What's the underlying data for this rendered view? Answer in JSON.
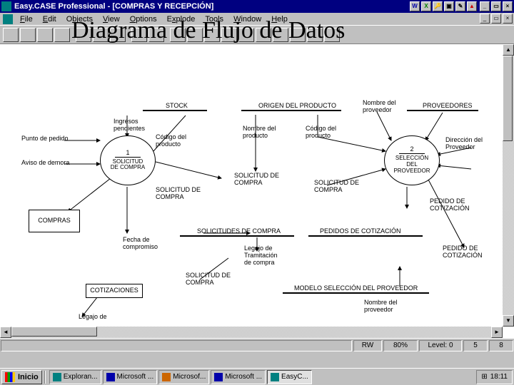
{
  "title": "Easy.CASE Professional - [COMPRAS Y RECEPCIÓN]",
  "overlayTitle": "Diagrama de Flujo de Datos",
  "menu": {
    "file": "File",
    "edit": "Edit",
    "objects": "Objects",
    "view": "View",
    "options": "Options",
    "explode": "Explode",
    "tools": "Tools",
    "window": "Window",
    "help": "Help"
  },
  "diagram": {
    "labels": {
      "puntoPedido": "Punto de pedido",
      "avisoDemora": "Aviso de demora",
      "ingresosPendientes": "Ingresos\npendientes",
      "codigoProducto": "Código del\nproducto",
      "stock": "STOCK",
      "origenProducto": "ORIGEN DEL PRODUCTO",
      "nombreProveedor": "Nombre del\nproveedor",
      "proveedores": "PROVEEDORES",
      "nombreProducto": "Nombre del\nproducto",
      "codigoProducto2": "Código del\nproducto",
      "direccionProveedor": "Dirección del\nProveedor",
      "solicitudCompra1": "SOLICITUD DE\nCOMPRA",
      "solicitudCompra2": "SOLICITUD DE\nCOMPRA",
      "solicitudCompra3": "SOLICITUD DE\nCOMPRA",
      "solicitudesCompra": "SOLICITUDES DE COMPRA",
      "pedidosCotizacion": "PEDIDOS DE COTIZACIÓN",
      "pedidoCotizacion": "PEDIDO DE\nCOTIZACIÓN",
      "pedidoCotizacion2": "PEDIDO DE\nCOTIZACIÓN",
      "fechaCompromiso": "Fecha de\ncompromiso",
      "legajoTramitacion": "Legajo de\nTramitación\nde compra",
      "solicitudCompra4": "SOLICITUD DE\nCOMPRA",
      "modeloSeleccion": "MODELO SELECCIÓN DEL PROVEEDOR",
      "nombreProveedor2": "Nombre del\nproveedor",
      "legajoDe": "Legajo de"
    },
    "entities": {
      "compras": "COMPRAS",
      "cotizaciones": "COTIZACIONES"
    },
    "processes": {
      "p1": {
        "num": "1",
        "name": "SOLICITUD\nDE COMPRA"
      },
      "p2": {
        "num": "2",
        "name": "SELECCIÓN\nDEL\nPROVEEDOR"
      }
    }
  },
  "status": {
    "rw": "RW",
    "zoom": "80%",
    "level": "Level: 0",
    "col": "5",
    "row": "8"
  },
  "taskbar": {
    "start": "Inicio",
    "tasks": [
      "Exploran...",
      "Microsoft ...",
      "Microsof...",
      "Microsoft ...",
      "EasyC..."
    ],
    "time": "18:11"
  }
}
